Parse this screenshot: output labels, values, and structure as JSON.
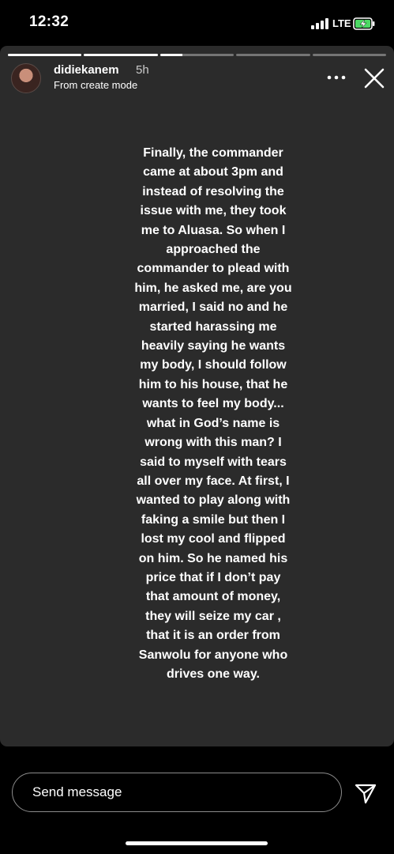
{
  "status_bar": {
    "time": "12:32",
    "network": "LTE",
    "signal_icon": "cellular-signal-icon",
    "battery_icon": "battery-charging-icon",
    "battery_color": "#4cd964"
  },
  "story": {
    "progress": [
      1.0,
      1.0,
      0.3,
      0.0,
      0.0
    ],
    "username": "didiekanem",
    "time_ago": "5h",
    "subtitle": "From create mode",
    "background_color": "#2b2b2b",
    "more_icon": "more-options-icon",
    "close_icon": "close-icon",
    "text": "Finally, the commander\ncame at about 3pm and\ninstead of resolving the\nissue with me, they took\nme to Aluasa. So when I\napproached the\ncommander to plead with\nhim, he asked me, are you\nmarried, I said no and he\nstarted harassing me\nheavily saying he wants\nmy body, I should follow\nhim to his house, that he\nwants to feel my body...\nwhat in God’s name is\nwrong with this man? I\nsaid to myself with tears\nall over my face.  At first, I\nwanted to play along with\nfaking a smile but then I\nlost my cool and flipped\non him.  So he named his\nprice that if I don’t pay\nthat amount of money,\nthey will seize my car ,\nthat it is an order from\nSanwolu for anyone who\ndrives one way."
  },
  "reply": {
    "placeholder": "Send message",
    "send_icon": "send-icon"
  }
}
